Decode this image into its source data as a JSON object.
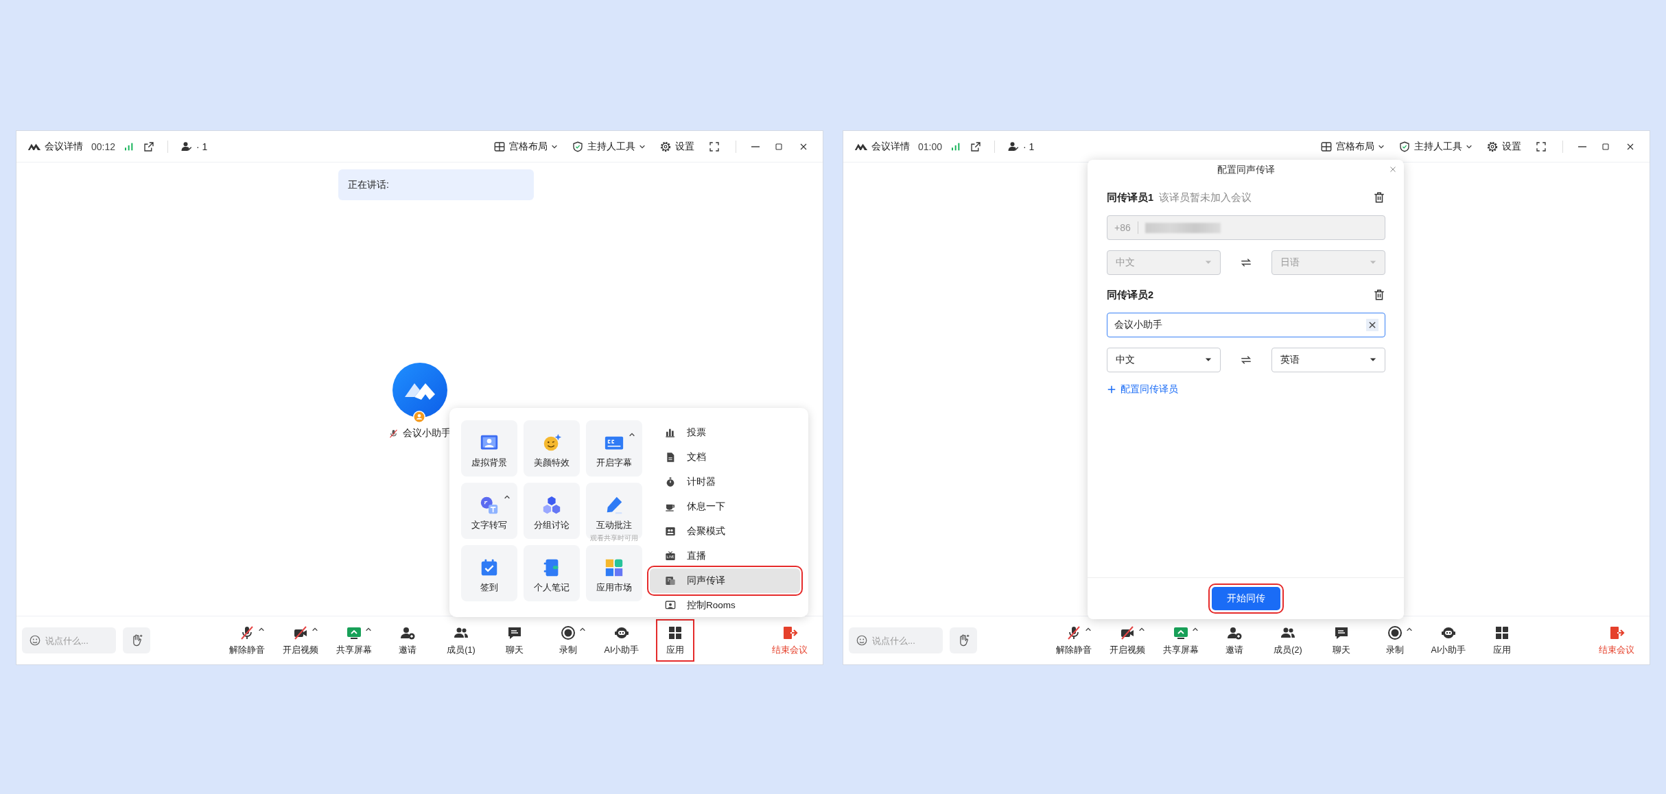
{
  "windows": [
    {
      "title_bar": {
        "title": "会议详情",
        "timer": "00:12",
        "participants": "· 1",
        "menus": [
          {
            "label": "宫格布局",
            "caret": true
          },
          {
            "label": "主持人工具",
            "caret": true
          },
          {
            "label": "设置",
            "caret": false
          }
        ]
      },
      "speaking_banner": "正在讲话:",
      "participant": {
        "name": "会议小助手",
        "muted": true
      },
      "apps_menu": {
        "tiles": [
          {
            "label": "虚拟背景",
            "caret": false
          },
          {
            "label": "美颜特效",
            "caret": false
          },
          {
            "label": "开启字幕",
            "caret": true
          },
          {
            "label": "文字转写",
            "caret": true
          },
          {
            "label": "分组讨论",
            "caret": false
          },
          {
            "label": "互动批注",
            "caret": false,
            "note": "观看共享时可用"
          },
          {
            "label": "签到",
            "caret": false
          },
          {
            "label": "个人笔记",
            "caret": false
          },
          {
            "label": "应用市场",
            "caret": false
          }
        ],
        "list": [
          {
            "label": "投票",
            "selected": false
          },
          {
            "label": "文档",
            "selected": false
          },
          {
            "label": "计时器",
            "selected": false
          },
          {
            "label": "休息一下",
            "selected": false
          },
          {
            "label": "会聚模式",
            "selected": false
          },
          {
            "label": "直播",
            "selected": false
          },
          {
            "label": "同声传译",
            "selected": true
          },
          {
            "label": "控制Rooms",
            "selected": false
          }
        ]
      },
      "toolbar": {
        "chat_placeholder": "说点什么...",
        "controls": [
          {
            "label": "解除静音",
            "caret": true,
            "highlighted": false
          },
          {
            "label": "开启视频",
            "caret": true,
            "highlighted": false
          },
          {
            "label": "共享屏幕",
            "caret": true,
            "highlighted": false
          },
          {
            "label": "邀请",
            "caret": false,
            "highlighted": false
          },
          {
            "label": "成员(1)",
            "caret": false,
            "highlighted": false
          },
          {
            "label": "聊天",
            "caret": false,
            "highlighted": false
          },
          {
            "label": "录制",
            "caret": true,
            "highlighted": false
          },
          {
            "label": "AI小助手",
            "caret": false,
            "highlighted": false
          },
          {
            "label": "应用",
            "caret": false,
            "highlighted": true
          }
        ],
        "end_button": "结束会议"
      }
    },
    {
      "title_bar": {
        "title": "会议详情",
        "timer": "01:00",
        "participants": "· 1",
        "menus": [
          {
            "label": "宫格布局",
            "caret": true
          },
          {
            "label": "主持人工具",
            "caret": true
          },
          {
            "label": "设置",
            "caret": false
          }
        ]
      },
      "dialog": {
        "title": "配置同声传译",
        "interpreters": [
          {
            "kind": "phone",
            "heading": "同传译员1",
            "status": "该译员暂未加入会议",
            "prefix": "+86",
            "disabled": true,
            "focused": false,
            "from": "中文",
            "to": "日语"
          },
          {
            "kind": "name",
            "heading": "同传译员2",
            "value": "会议小助手",
            "disabled": false,
            "focused": true,
            "from": "中文",
            "to": "英语"
          }
        ],
        "add_link": "配置同传译员",
        "start_button": {
          "label": "开始同传",
          "highlighted": true
        }
      },
      "toolbar": {
        "chat_placeholder": "说点什么...",
        "controls": [
          {
            "label": "解除静音",
            "caret": true,
            "highlighted": false
          },
          {
            "label": "开启视频",
            "caret": true,
            "highlighted": false
          },
          {
            "label": "共享屏幕",
            "caret": true,
            "highlighted": false
          },
          {
            "label": "邀请",
            "caret": false,
            "highlighted": false
          },
          {
            "label": "成员(2)",
            "caret": false,
            "highlighted": false
          },
          {
            "label": "聊天",
            "caret": false,
            "highlighted": false
          },
          {
            "label": "录制",
            "caret": true,
            "highlighted": false
          },
          {
            "label": "AI小助手",
            "caret": false,
            "highlighted": false
          },
          {
            "label": "应用",
            "caret": false,
            "highlighted": false
          }
        ],
        "end_button": "结束会议"
      }
    }
  ]
}
